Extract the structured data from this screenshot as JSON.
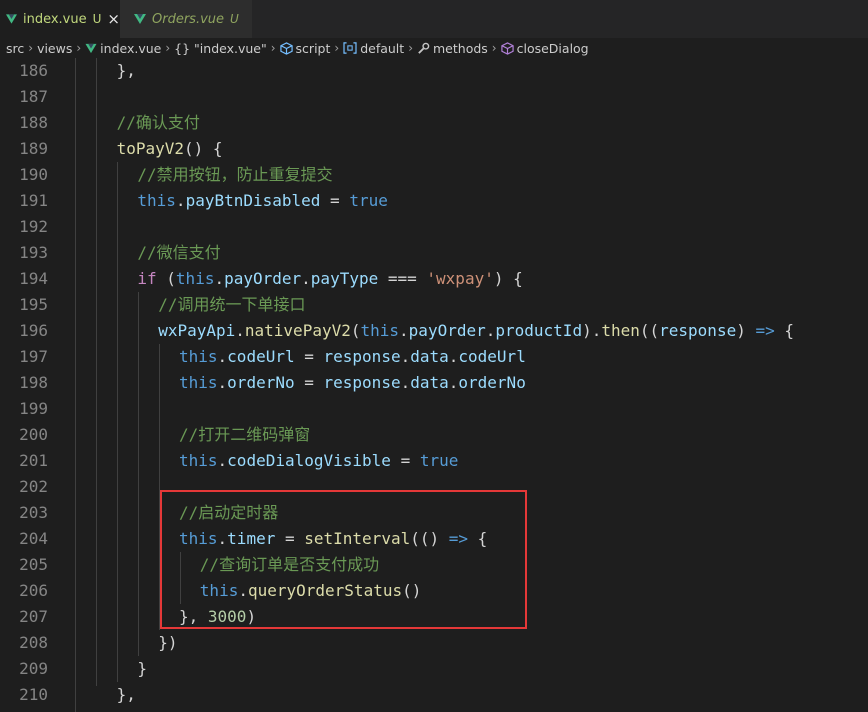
{
  "tabs": [
    {
      "label": "index.vue",
      "badge": "U",
      "active": true,
      "close": "×"
    },
    {
      "label": "Orders.vue",
      "badge": "U",
      "active": false
    }
  ],
  "breadcrumb": [
    "src",
    "views",
    "index.vue",
    "{} \"index.vue\"",
    "script",
    "default",
    "methods",
    "closeDialog"
  ],
  "breadcrumb_icons": [
    "",
    "",
    "vue-icon",
    "",
    "cube-icon",
    "brackets-icon",
    "wrench-icon",
    "method-cube-icon"
  ],
  "colors": {
    "background": "#1e1e1e",
    "line_number": "#858585",
    "comment": "#6a9955",
    "keyword_blue": "#569cd6",
    "keyword_control": "#c586c0",
    "variable": "#9cdcfe",
    "function": "#dcdcaa",
    "string": "#ce9178",
    "number": "#b5cea8",
    "plain": "#d4d4d4",
    "highlight_box": "#e53838",
    "vue_green": "#41b883",
    "tab_label_active": "#c1d87d"
  },
  "code": [
    {
      "n": "186",
      "indent": 4,
      "tokens": [
        {
          "t": "},",
          "c": "plain"
        }
      ]
    },
    {
      "n": "187",
      "indent": 0,
      "tokens": []
    },
    {
      "n": "188",
      "indent": 4,
      "tokens": [
        {
          "t": "//确认支付",
          "c": "comment"
        }
      ]
    },
    {
      "n": "189",
      "indent": 4,
      "tokens": [
        {
          "t": "toPayV2",
          "c": "function"
        },
        {
          "t": "() {",
          "c": "plain"
        }
      ]
    },
    {
      "n": "190",
      "indent": 6,
      "tokens": [
        {
          "t": "//禁用按钮，防止重复提交",
          "c": "comment"
        }
      ]
    },
    {
      "n": "191",
      "indent": 6,
      "tokens": [
        {
          "t": "this",
          "c": "keyword_blue"
        },
        {
          "t": ".",
          "c": "plain"
        },
        {
          "t": "payBtnDisabled",
          "c": "variable"
        },
        {
          "t": " = ",
          "c": "plain"
        },
        {
          "t": "true",
          "c": "keyword_blue"
        }
      ]
    },
    {
      "n": "192",
      "indent": 0,
      "tokens": []
    },
    {
      "n": "193",
      "indent": 6,
      "tokens": [
        {
          "t": "//微信支付",
          "c": "comment"
        }
      ]
    },
    {
      "n": "194",
      "indent": 6,
      "tokens": [
        {
          "t": "if",
          "c": "keyword_control"
        },
        {
          "t": " (",
          "c": "plain"
        },
        {
          "t": "this",
          "c": "keyword_blue"
        },
        {
          "t": ".",
          "c": "plain"
        },
        {
          "t": "payOrder",
          "c": "variable"
        },
        {
          "t": ".",
          "c": "plain"
        },
        {
          "t": "payType",
          "c": "variable"
        },
        {
          "t": " === ",
          "c": "plain"
        },
        {
          "t": "'wxpay'",
          "c": "string"
        },
        {
          "t": ") {",
          "c": "plain"
        }
      ]
    },
    {
      "n": "195",
      "indent": 8,
      "tokens": [
        {
          "t": "//调用统一下单接口",
          "c": "comment"
        }
      ]
    },
    {
      "n": "196",
      "indent": 8,
      "tokens": [
        {
          "t": "wxPayApi",
          "c": "variable"
        },
        {
          "t": ".",
          "c": "plain"
        },
        {
          "t": "nativePayV2",
          "c": "function"
        },
        {
          "t": "(",
          "c": "plain"
        },
        {
          "t": "this",
          "c": "keyword_blue"
        },
        {
          "t": ".",
          "c": "plain"
        },
        {
          "t": "payOrder",
          "c": "variable"
        },
        {
          "t": ".",
          "c": "plain"
        },
        {
          "t": "productId",
          "c": "variable"
        },
        {
          "t": ").",
          "c": "plain"
        },
        {
          "t": "then",
          "c": "function"
        },
        {
          "t": "((",
          "c": "plain"
        },
        {
          "t": "response",
          "c": "variable"
        },
        {
          "t": ") ",
          "c": "plain"
        },
        {
          "t": "=>",
          "c": "keyword_blue"
        },
        {
          "t": " {",
          "c": "plain"
        }
      ]
    },
    {
      "n": "197",
      "indent": 10,
      "tokens": [
        {
          "t": "this",
          "c": "keyword_blue"
        },
        {
          "t": ".",
          "c": "plain"
        },
        {
          "t": "codeUrl",
          "c": "variable"
        },
        {
          "t": " = ",
          "c": "plain"
        },
        {
          "t": "response",
          "c": "variable"
        },
        {
          "t": ".",
          "c": "plain"
        },
        {
          "t": "data",
          "c": "variable"
        },
        {
          "t": ".",
          "c": "plain"
        },
        {
          "t": "codeUrl",
          "c": "variable"
        }
      ]
    },
    {
      "n": "198",
      "indent": 10,
      "tokens": [
        {
          "t": "this",
          "c": "keyword_blue"
        },
        {
          "t": ".",
          "c": "plain"
        },
        {
          "t": "orderNo",
          "c": "variable"
        },
        {
          "t": " = ",
          "c": "plain"
        },
        {
          "t": "response",
          "c": "variable"
        },
        {
          "t": ".",
          "c": "plain"
        },
        {
          "t": "data",
          "c": "variable"
        },
        {
          "t": ".",
          "c": "plain"
        },
        {
          "t": "orderNo",
          "c": "variable"
        }
      ]
    },
    {
      "n": "199",
      "indent": 0,
      "tokens": []
    },
    {
      "n": "200",
      "indent": 10,
      "tokens": [
        {
          "t": "//打开二维码弹窗",
          "c": "comment"
        }
      ]
    },
    {
      "n": "201",
      "indent": 10,
      "tokens": [
        {
          "t": "this",
          "c": "keyword_blue"
        },
        {
          "t": ".",
          "c": "plain"
        },
        {
          "t": "codeDialogVisible",
          "c": "variable"
        },
        {
          "t": " = ",
          "c": "plain"
        },
        {
          "t": "true",
          "c": "keyword_blue"
        }
      ]
    },
    {
      "n": "202",
      "indent": 0,
      "tokens": []
    },
    {
      "n": "203",
      "indent": 10,
      "tokens": [
        {
          "t": "//启动定时器",
          "c": "comment"
        }
      ]
    },
    {
      "n": "204",
      "indent": 10,
      "tokens": [
        {
          "t": "this",
          "c": "keyword_blue"
        },
        {
          "t": ".",
          "c": "plain"
        },
        {
          "t": "timer",
          "c": "variable"
        },
        {
          "t": " = ",
          "c": "plain"
        },
        {
          "t": "setInterval",
          "c": "function"
        },
        {
          "t": "(() ",
          "c": "plain"
        },
        {
          "t": "=>",
          "c": "keyword_blue"
        },
        {
          "t": " {",
          "c": "plain"
        }
      ]
    },
    {
      "n": "205",
      "indent": 12,
      "tokens": [
        {
          "t": "//查询订单是否支付成功",
          "c": "comment"
        }
      ]
    },
    {
      "n": "206",
      "indent": 12,
      "tokens": [
        {
          "t": "this",
          "c": "keyword_blue"
        },
        {
          "t": ".",
          "c": "plain"
        },
        {
          "t": "queryOrderStatus",
          "c": "function"
        },
        {
          "t": "()",
          "c": "plain"
        }
      ]
    },
    {
      "n": "207",
      "indent": 10,
      "tokens": [
        {
          "t": "}, ",
          "c": "plain"
        },
        {
          "t": "3000",
          "c": "number"
        },
        {
          "t": ")",
          "c": "plain"
        }
      ]
    },
    {
      "n": "208",
      "indent": 8,
      "tokens": [
        {
          "t": "})",
          "c": "plain"
        }
      ]
    },
    {
      "n": "209",
      "indent": 6,
      "tokens": [
        {
          "t": "}",
          "c": "plain"
        }
      ]
    },
    {
      "n": "210",
      "indent": 4,
      "tokens": [
        {
          "t": "},",
          "c": "plain"
        }
      ]
    }
  ]
}
